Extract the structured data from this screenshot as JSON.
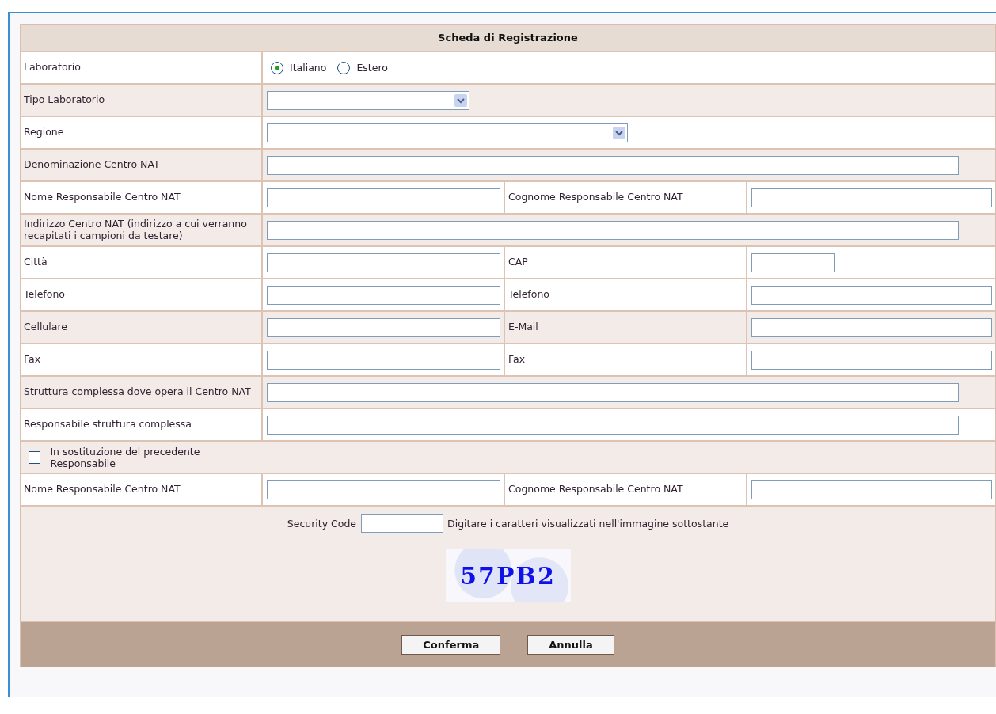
{
  "form": {
    "title": "Scheda di Registrazione",
    "rows": [
      {
        "kind": "radio",
        "label": "Laboratorio",
        "options": [
          {
            "label": "Italiano",
            "selected": true
          },
          {
            "label": "Estero",
            "selected": false
          }
        ]
      },
      {
        "kind": "select",
        "label": "Tipo Laboratorio"
      },
      {
        "kind": "select",
        "label": "Regione"
      },
      {
        "kind": "text",
        "label": "Denominazione Centro NAT"
      },
      {
        "kind": "pair",
        "fields": [
          {
            "label": "Nome Responsabile Centro NAT"
          },
          {
            "label": "Cognome Responsabile Centro NAT"
          }
        ]
      },
      {
        "kind": "text",
        "label": "Indirizzo Centro NAT (indirizzo a cui verranno recapitati i campioni da testare)"
      },
      {
        "kind": "pair",
        "fields": [
          {
            "label": "Città"
          },
          {
            "label": "CAP"
          }
        ]
      },
      {
        "kind": "pair",
        "fields": [
          {
            "label": "Telefono"
          },
          {
            "label": "Telefono"
          }
        ]
      },
      {
        "kind": "pair",
        "fields": [
          {
            "label": "Cellulare"
          },
          {
            "label": "E-Mail"
          }
        ]
      },
      {
        "kind": "pair",
        "fields": [
          {
            "label": "Fax"
          },
          {
            "label": "Fax"
          }
        ]
      },
      {
        "kind": "text",
        "label": "Struttura complessa dove opera il Centro NAT"
      },
      {
        "kind": "text",
        "label": "Responsabile struttura complessa"
      },
      {
        "kind": "checkbox",
        "label": "In sostituzione del precedente Responsabile",
        "checked": false
      },
      {
        "kind": "pair",
        "fields": [
          {
            "label": "Nome Responsabile Centro NAT"
          },
          {
            "label": "Cognome Responsabile Centro NAT"
          }
        ]
      }
    ],
    "security": {
      "label": "Security Code",
      "hint": "Digitare i caratteri visualizzati nell'immagine sottostante",
      "captcha": "57PB2"
    },
    "buttons": [
      "Conferma",
      "Annulla"
    ]
  }
}
